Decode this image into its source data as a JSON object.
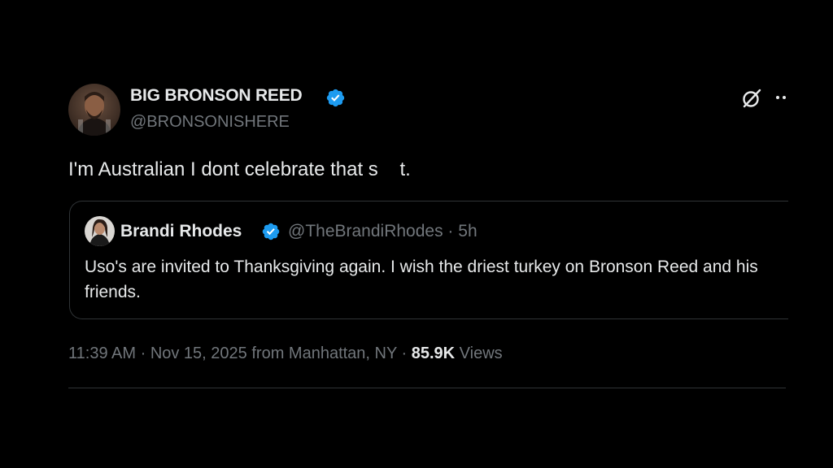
{
  "tweet": {
    "author": {
      "display_name": "BIG BRONSON REED",
      "handle": "@BRONSONISHERE",
      "verified_icon": "verified-badge-icon",
      "avatar": "avatar"
    },
    "text": "I'm Australian I dont celebrate that s    t.",
    "actions": {
      "grok_icon": "grok-icon",
      "more_icon": "more-options-icon"
    },
    "quoted": {
      "display_name": "Brandi Rhodes",
      "handle": "@TheBrandiRhodes",
      "separator": " · ",
      "age": "5h",
      "text": "Uso's are invited to Thanksgiving again. I wish the driest turkey on Bronson Reed and his friends."
    },
    "meta": {
      "time": "11:39 AM",
      "separator1": " · ",
      "date": "Nov 15, 2025",
      "location": " from Manhattan, NY",
      "separator2": " · ",
      "views_count": "85.9K",
      "views_label": " Views"
    }
  },
  "colors": {
    "background": "#000000",
    "primary_text": "#e7e9ea",
    "secondary_text": "#71767b",
    "verified_blue": "#1d9bf0",
    "border": "#2f3336"
  }
}
